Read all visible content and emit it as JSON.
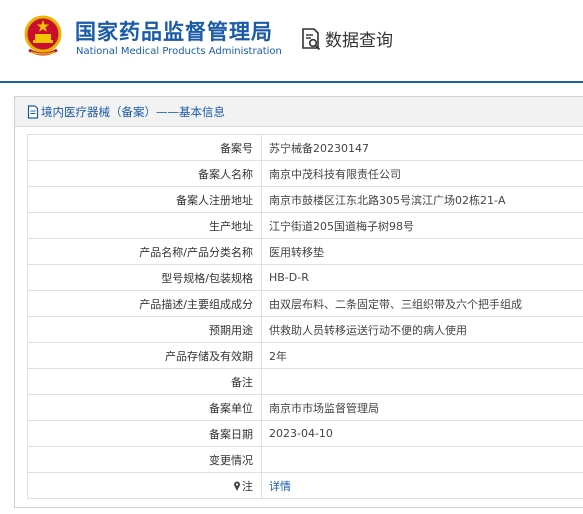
{
  "header": {
    "logo_cn": "国家药品监督管理局",
    "logo_en": "National Medical Products Administration",
    "query_label": "数据查询",
    "emblem_icon": "national-emblem-icon",
    "query_icon": "document-search-icon",
    "brand_color": "#1a5ba8"
  },
  "panel": {
    "title": "境内医疗器械（备案）——基本信息",
    "title_icon": "document-icon"
  },
  "rows": [
    {
      "label": "备案号",
      "value": "苏宁械备20230147"
    },
    {
      "label": "备案人名称",
      "value": "南京中茂科技有限责任公司"
    },
    {
      "label": "备案人注册地址",
      "value": "南京市鼓楼区江东北路305号滨江广场02栋21-A"
    },
    {
      "label": "生产地址",
      "value": "江宁街道205国道梅子树98号"
    },
    {
      "label": "产品名称/产品分类名称",
      "value": "医用转移垫"
    },
    {
      "label": "型号规格/包装规格",
      "value": "HB-D-R"
    },
    {
      "label": "产品描述/主要组成成分",
      "value": "由双层布料、二条固定带、三组织带及六个把手组成"
    },
    {
      "label": "预期用途",
      "value": "供救助人员转移运送行动不便的病人使用"
    },
    {
      "label": "产品存储及有效期",
      "value": "2年"
    },
    {
      "label": "备注",
      "value": ""
    },
    {
      "label": "备案单位",
      "value": "南京市市场监督管理局"
    },
    {
      "label": "备案日期",
      "value": "2023-04-10"
    },
    {
      "label": "变更情况",
      "value": ""
    },
    {
      "label": "注",
      "value": "详情",
      "icon": "pin-icon"
    }
  ]
}
